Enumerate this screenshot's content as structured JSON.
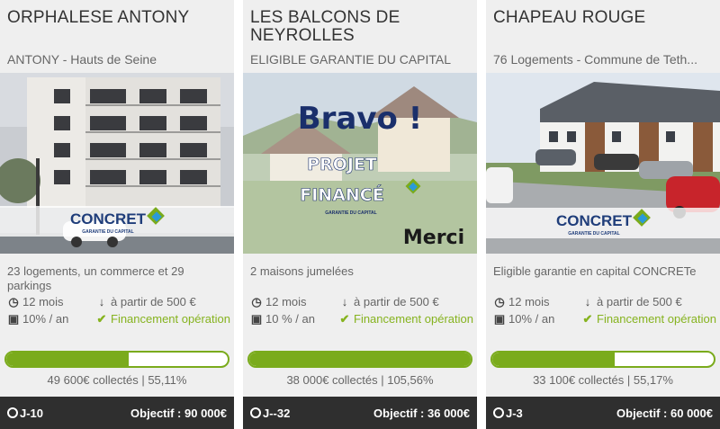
{
  "projects": [
    {
      "title": "ORPHALESE ANTONY",
      "subtitle": "ANTONY - Hauts de Seine",
      "image_logo": "CONCRET",
      "image_logo_sub": "GARANTIE DU CAPITAL",
      "description": "23 logements, un commerce et 29 parkings",
      "duration": "12 mois",
      "rate": "10% / an",
      "min_invest": "à partir de 500 €",
      "financing": "Financement opération",
      "progress": 55.11,
      "collected": "49 600€ collectés | 55,11%",
      "days_left": "J-10",
      "objective": "Objectif : 90 000€"
    },
    {
      "title": "LES BALCONS DE NEYROLLES",
      "subtitle": "ELIGIBLE GARANTIE DU CAPITAL",
      "image_line1": "Bravo !",
      "image_line2": "PROJET",
      "image_line3": "FINANCÉ",
      "image_logo_sub": "GARANTIE DU CAPITAL",
      "image_line4": "Merci",
      "description": "2 maisons jumelées",
      "duration": "12 mois",
      "rate": "10 % / an",
      "min_invest": "à partir de 500 €",
      "financing": "Financement opération",
      "progress": 100,
      "collected": "38 000€ collectés | 105,56%",
      "days_left": "J--32",
      "objective": "Objectif : 36 000€"
    },
    {
      "title": "CHAPEAU ROUGE",
      "subtitle": "76 Logements - Commune de Teth...",
      "image_logo": "CONCRET",
      "image_logo_sub": "GARANTIE DU CAPITAL",
      "description": "Eligible garantie en capital CONCRETe",
      "duration": "12 mois",
      "rate": "10% / an",
      "min_invest": "à partir de 500 €",
      "financing": "Financement opération",
      "progress": 55.17,
      "collected": "33 100€ collectés | 55,17%",
      "days_left": "J-3",
      "objective": "Objectif : 60 000€"
    }
  ],
  "icons": {
    "duration": "clock-icon",
    "rate": "banknote-icon",
    "min_invest": "arrow-down-icon",
    "financing": "check-icon"
  },
  "colors": {
    "accent_green": "#7aab1c",
    "footer_bg": "#2f2f2f",
    "card_bg": "#efefef"
  }
}
